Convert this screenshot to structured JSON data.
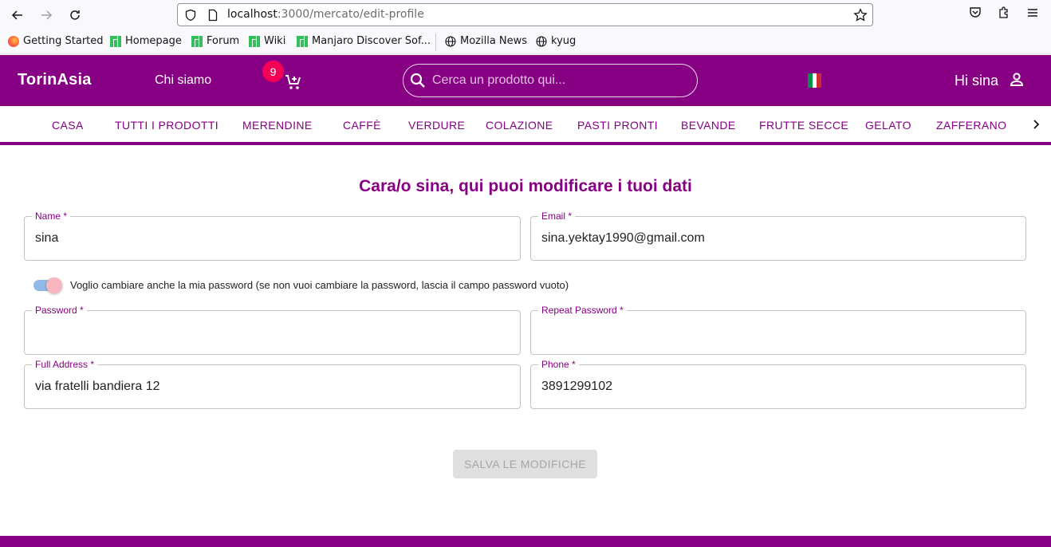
{
  "browser": {
    "url_host": "localhost",
    "url_path": ":3000/mercato/edit-profile",
    "bookmarks": [
      "Getting Started",
      "Homepage",
      "Forum",
      "Wiki",
      "Manjaro Discover Sof...",
      "Mozilla News",
      "kyug"
    ]
  },
  "header": {
    "brand": "TorinAsia",
    "about_link": "Chi siamo",
    "cart_count": "9",
    "search_placeholder": "Cerca un prodotto qui...",
    "greeting": "Hi sina",
    "primary_color": "#870083",
    "badge_color": "#f50057"
  },
  "categories": [
    "CASA",
    "TUTTI I PRODOTTI",
    "MERENDINE",
    "CAFFÈ",
    "VERDURE",
    "COLAZIONE",
    "PASTI PRONTI",
    "BEVANDE",
    "FRUTTE SECCE",
    "GELATO",
    "ZAFFERANO"
  ],
  "form": {
    "title": "Cara/o sina, qui puoi modificare i tuoi dati",
    "name_label": "Name",
    "name_value": "sina",
    "email_label": "Email",
    "email_value": "sina.yektay1990@gmail.com",
    "toggle_label": "Voglio cambiare anche la mia password (se non vuoi cambiare la password, lascia il campo password vuoto)",
    "toggle_on": true,
    "password_label": "Password",
    "password_value": "",
    "repeat_password_label": "Repeat Password",
    "repeat_password_value": "",
    "address_label": "Full Address",
    "address_value": "via fratelli bandiera 12",
    "phone_label": "Phone",
    "phone_value": "3891299102",
    "required_marker": "*",
    "save_label": "SALVA LE MODIFICHE"
  }
}
